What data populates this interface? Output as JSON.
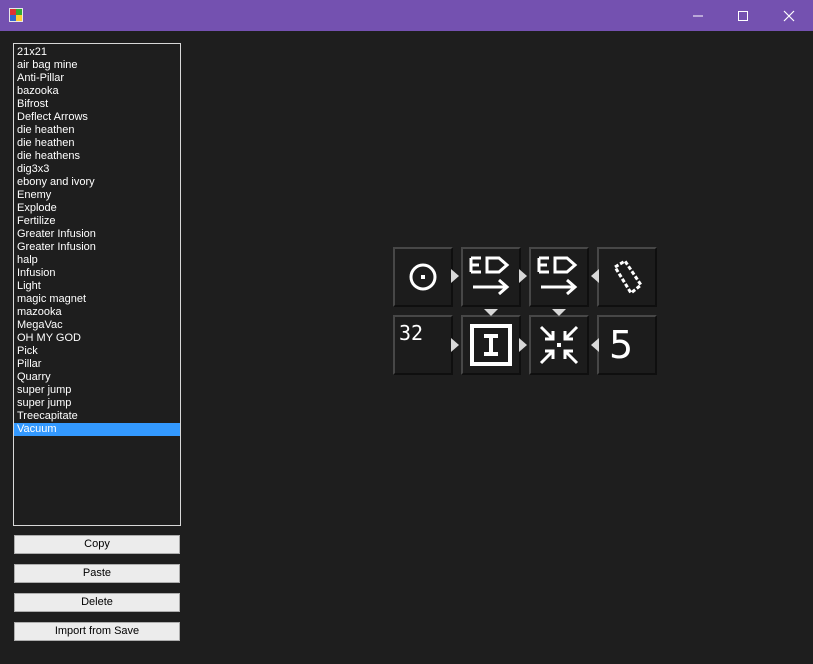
{
  "window": {
    "title_icon": "app-icon",
    "controls": [
      "minimize-icon",
      "maximize-icon",
      "close-icon"
    ]
  },
  "macros": {
    "items": [
      "21x21",
      "air bag mine",
      "Anti-Pillar",
      "bazooka",
      "Bifrost",
      "Deflect Arrows",
      "die heathen",
      "die heathen",
      "die heathens",
      "dig3x3",
      "ebony and ivory",
      "Enemy",
      "Explode",
      "Fertilize",
      "Greater Infusion",
      "Greater Infusion",
      "halp",
      "Infusion",
      "Light",
      "magic magnet",
      "mazooka",
      "MegaVac",
      "OH MY GOD",
      "Pick",
      "Pillar",
      "Quarry",
      "super jump",
      "super jump",
      "Treecapitate",
      "Vacuum"
    ],
    "selected_index": 29
  },
  "buttons": {
    "copy": "Copy",
    "paste": "Paste",
    "delete": "Delete",
    "import": "Import from Save"
  },
  "canvas": {
    "tiles": {
      "count_value": "32",
      "digit_value": "5",
      "icons": [
        "circle-target-icon",
        "ed-arrow-icon",
        "ed-arrow-icon",
        "diamond-rune-icon",
        "input-box-icon",
        "implode-arrows-icon"
      ]
    }
  }
}
